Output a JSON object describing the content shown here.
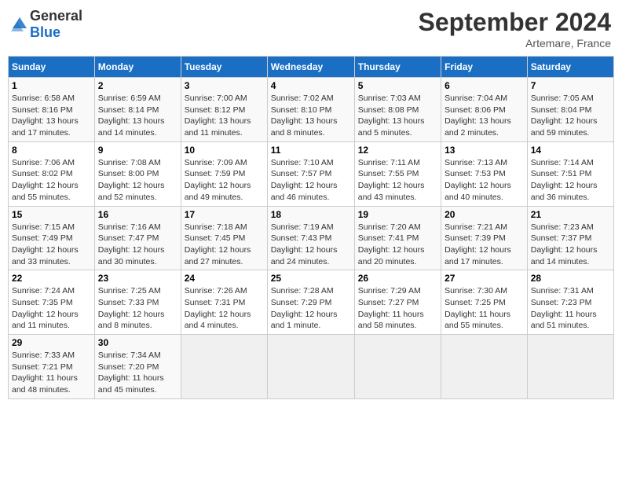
{
  "header": {
    "logo_general": "General",
    "logo_blue": "Blue",
    "month_title": "September 2024",
    "subtitle": "Artemare, France"
  },
  "columns": [
    "Sunday",
    "Monday",
    "Tuesday",
    "Wednesday",
    "Thursday",
    "Friday",
    "Saturday"
  ],
  "weeks": [
    [
      {
        "day": "1",
        "info": "Sunrise: 6:58 AM\nSunset: 8:16 PM\nDaylight: 13 hours\nand 17 minutes."
      },
      {
        "day": "2",
        "info": "Sunrise: 6:59 AM\nSunset: 8:14 PM\nDaylight: 13 hours\nand 14 minutes."
      },
      {
        "day": "3",
        "info": "Sunrise: 7:00 AM\nSunset: 8:12 PM\nDaylight: 13 hours\nand 11 minutes."
      },
      {
        "day": "4",
        "info": "Sunrise: 7:02 AM\nSunset: 8:10 PM\nDaylight: 13 hours\nand 8 minutes."
      },
      {
        "day": "5",
        "info": "Sunrise: 7:03 AM\nSunset: 8:08 PM\nDaylight: 13 hours\nand 5 minutes."
      },
      {
        "day": "6",
        "info": "Sunrise: 7:04 AM\nSunset: 8:06 PM\nDaylight: 13 hours\nand 2 minutes."
      },
      {
        "day": "7",
        "info": "Sunrise: 7:05 AM\nSunset: 8:04 PM\nDaylight: 12 hours\nand 59 minutes."
      }
    ],
    [
      {
        "day": "8",
        "info": "Sunrise: 7:06 AM\nSunset: 8:02 PM\nDaylight: 12 hours\nand 55 minutes."
      },
      {
        "day": "9",
        "info": "Sunrise: 7:08 AM\nSunset: 8:00 PM\nDaylight: 12 hours\nand 52 minutes."
      },
      {
        "day": "10",
        "info": "Sunrise: 7:09 AM\nSunset: 7:59 PM\nDaylight: 12 hours\nand 49 minutes."
      },
      {
        "day": "11",
        "info": "Sunrise: 7:10 AM\nSunset: 7:57 PM\nDaylight: 12 hours\nand 46 minutes."
      },
      {
        "day": "12",
        "info": "Sunrise: 7:11 AM\nSunset: 7:55 PM\nDaylight: 12 hours\nand 43 minutes."
      },
      {
        "day": "13",
        "info": "Sunrise: 7:13 AM\nSunset: 7:53 PM\nDaylight: 12 hours\nand 40 minutes."
      },
      {
        "day": "14",
        "info": "Sunrise: 7:14 AM\nSunset: 7:51 PM\nDaylight: 12 hours\nand 36 minutes."
      }
    ],
    [
      {
        "day": "15",
        "info": "Sunrise: 7:15 AM\nSunset: 7:49 PM\nDaylight: 12 hours\nand 33 minutes."
      },
      {
        "day": "16",
        "info": "Sunrise: 7:16 AM\nSunset: 7:47 PM\nDaylight: 12 hours\nand 30 minutes."
      },
      {
        "day": "17",
        "info": "Sunrise: 7:18 AM\nSunset: 7:45 PM\nDaylight: 12 hours\nand 27 minutes."
      },
      {
        "day": "18",
        "info": "Sunrise: 7:19 AM\nSunset: 7:43 PM\nDaylight: 12 hours\nand 24 minutes."
      },
      {
        "day": "19",
        "info": "Sunrise: 7:20 AM\nSunset: 7:41 PM\nDaylight: 12 hours\nand 20 minutes."
      },
      {
        "day": "20",
        "info": "Sunrise: 7:21 AM\nSunset: 7:39 PM\nDaylight: 12 hours\nand 17 minutes."
      },
      {
        "day": "21",
        "info": "Sunrise: 7:23 AM\nSunset: 7:37 PM\nDaylight: 12 hours\nand 14 minutes."
      }
    ],
    [
      {
        "day": "22",
        "info": "Sunrise: 7:24 AM\nSunset: 7:35 PM\nDaylight: 12 hours\nand 11 minutes."
      },
      {
        "day": "23",
        "info": "Sunrise: 7:25 AM\nSunset: 7:33 PM\nDaylight: 12 hours\nand 8 minutes."
      },
      {
        "day": "24",
        "info": "Sunrise: 7:26 AM\nSunset: 7:31 PM\nDaylight: 12 hours\nand 4 minutes."
      },
      {
        "day": "25",
        "info": "Sunrise: 7:28 AM\nSunset: 7:29 PM\nDaylight: 12 hours\nand 1 minute."
      },
      {
        "day": "26",
        "info": "Sunrise: 7:29 AM\nSunset: 7:27 PM\nDaylight: 11 hours\nand 58 minutes."
      },
      {
        "day": "27",
        "info": "Sunrise: 7:30 AM\nSunset: 7:25 PM\nDaylight: 11 hours\nand 55 minutes."
      },
      {
        "day": "28",
        "info": "Sunrise: 7:31 AM\nSunset: 7:23 PM\nDaylight: 11 hours\nand 51 minutes."
      }
    ],
    [
      {
        "day": "29",
        "info": "Sunrise: 7:33 AM\nSunset: 7:21 PM\nDaylight: 11 hours\nand 48 minutes."
      },
      {
        "day": "30",
        "info": "Sunrise: 7:34 AM\nSunset: 7:20 PM\nDaylight: 11 hours\nand 45 minutes."
      },
      {
        "day": "",
        "info": ""
      },
      {
        "day": "",
        "info": ""
      },
      {
        "day": "",
        "info": ""
      },
      {
        "day": "",
        "info": ""
      },
      {
        "day": "",
        "info": ""
      }
    ]
  ]
}
